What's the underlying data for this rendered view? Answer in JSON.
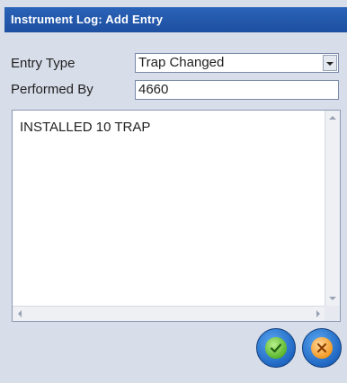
{
  "window": {
    "title": "Instrument Log: Add Entry"
  },
  "form": {
    "entry_type_label": "Entry Type",
    "entry_type_value": "Trap Changed",
    "performed_by_label": "Performed By",
    "performed_by_value": "4660",
    "notes_text": "INSTALLED 10 TRAP"
  },
  "icons": {
    "ok": "check-icon",
    "cancel": "x-icon"
  },
  "colors": {
    "titlebar": "#2a63b8",
    "background": "#d7dde9",
    "ok": "#59b52c",
    "cancel": "#f39a25"
  }
}
